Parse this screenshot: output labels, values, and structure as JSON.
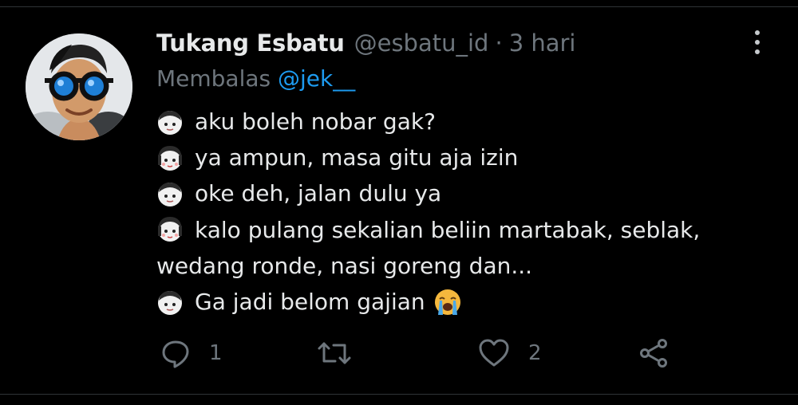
{
  "tweet": {
    "author_name": "Tukang Esbatu",
    "author_handle": "@esbatu_id",
    "separator": "·",
    "time": "3 hari",
    "reply_prefix": "Membalas",
    "reply_handle": "@jek__",
    "lines": [
      {
        "speaker": "boy",
        "text": "aku boleh nobar gak?"
      },
      {
        "speaker": "girl",
        "text": "ya ampun, masa gitu aja izin"
      },
      {
        "speaker": "boy",
        "text": "oke deh, jalan dulu ya"
      },
      {
        "speaker": "girl",
        "text": "kalo pulang sekalian beliin martabak, seblak, wedang ronde, nasi goreng dan..."
      },
      {
        "speaker": "boy",
        "text": "Ga jadi belom gajian",
        "trailing_emoji": "loudly-crying-face"
      }
    ],
    "actions": {
      "reply_count": "1",
      "retweet_count": "",
      "like_count": "2"
    }
  },
  "colors": {
    "background": "#000000",
    "text": "#e7e9ea",
    "muted": "#6e767d",
    "link": "#1d9bf0"
  },
  "icons": {
    "reply": "reply-icon",
    "retweet": "retweet-icon",
    "like": "heart-icon",
    "share": "share-icon",
    "more": "more-vertical-icon"
  }
}
